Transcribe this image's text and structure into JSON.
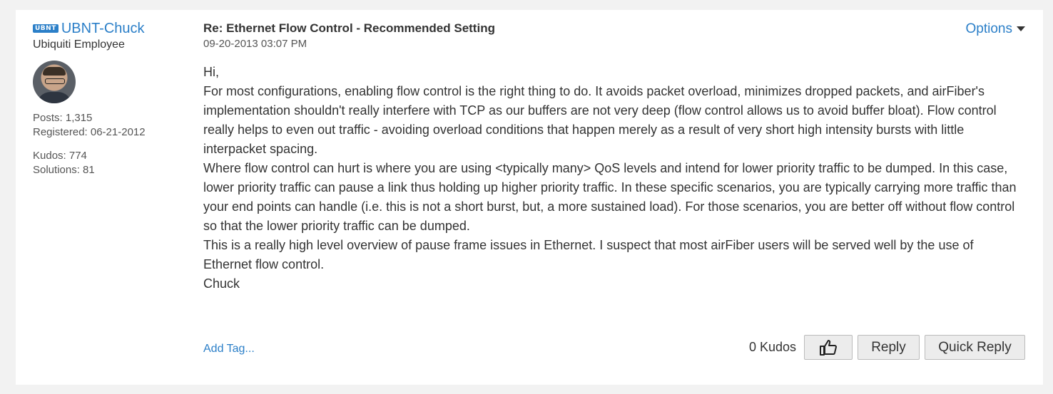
{
  "author": {
    "badge": "UBNT",
    "name": "UBNT-Chuck",
    "rank": "Ubiquiti Employee",
    "posts": "Posts: 1,315",
    "registered": "Registered: 06-21-2012",
    "kudos": "Kudos: 774",
    "solutions": "Solutions: 81"
  },
  "post": {
    "subject": "Re: Ethernet Flow Control - Recommended Setting",
    "date": "09-20-2013 03:07 PM",
    "options_label": "Options",
    "paragraphs": [
      "Hi,",
      "For most configurations, enabling flow control is the right thing to do. It avoids packet overload, minimizes dropped packets, and airFiber's implementation shouldn't really interfere with TCP as our buffers are not very deep (flow control allows us to avoid buffer bloat). Flow control really helps to even out traffic - avoiding overload conditions that happen merely as a result of very short high intensity bursts with little interpacket spacing.",
      "Where flow control can hurt is where you are using <typically many> QoS levels and intend for lower priority traffic to be dumped. In this case, lower priority traffic can pause a link thus holding up higher priority traffic. In these specific scenarios, you are typically carrying more traffic than your end points can handle (i.e. this is not a short burst, but, a more sustained load). For those scenarios, you are better off without flow control so that the lower priority traffic can be dumped.",
      "This is a really high level overview of pause frame issues in Ethernet. I suspect that most airFiber users will be served well by the use of Ethernet flow control.",
      "Chuck"
    ]
  },
  "footer": {
    "add_tag": "Add Tag...",
    "kudos_count": "0 Kudos",
    "like_icon": "thumbs-up-icon",
    "reply_label": "Reply",
    "quick_reply_label": "Quick Reply"
  },
  "colors": {
    "link": "#2b7fc8",
    "background": "#f2f2f2",
    "card": "#ffffff"
  }
}
